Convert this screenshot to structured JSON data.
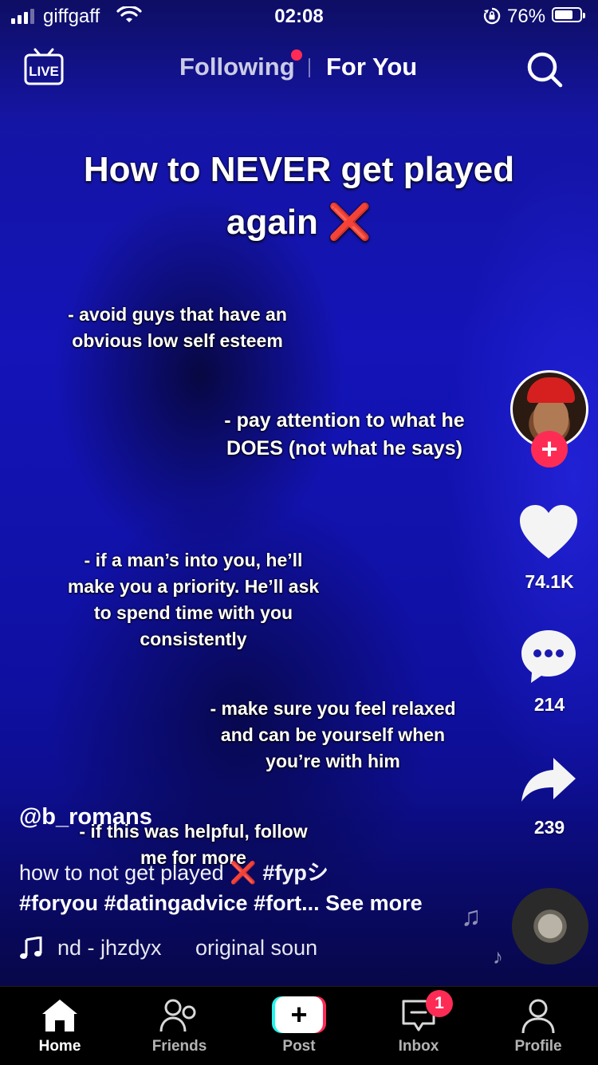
{
  "status_bar": {
    "carrier": "giffgaff",
    "time": "02:08",
    "battery_percent": "76%",
    "battery_level": 0.76
  },
  "top_nav": {
    "live_label": "LIVE",
    "following": "Following",
    "for_you": "For You"
  },
  "video": {
    "headline_line1": "How to NEVER get played",
    "headline_line2": "again",
    "headline_emoji": "❌",
    "tips": [
      [
        "- avoid guys that have an",
        "obvious low self esteem"
      ],
      [
        "- pay attention to what he",
        "DOES (not what he says)"
      ],
      [
        "- if a man’s into you, he’ll",
        "make you a priority. He’ll ask",
        "to spend time with you",
        "consistently"
      ],
      [
        "- make sure you feel relaxed",
        "and can be yourself when",
        "you’re with him"
      ],
      [
        "- if this was helpful, follow",
        "me for more"
      ]
    ]
  },
  "rail": {
    "likes": "74.1K",
    "comments": "214",
    "shares": "239"
  },
  "info": {
    "username": "@b_romans",
    "description_text": "how to not get played",
    "description_emoji": "❌",
    "description_tag": "#fypシ",
    "hashtags_line": "#foryou #datingadvice #fort...",
    "see_more": "See more",
    "music_text_1": "nd - jhzdyx",
    "music_text_2": "original soun"
  },
  "bottom_nav": {
    "home": "Home",
    "friends": "Friends",
    "post": "Post",
    "post_symbol": "+",
    "inbox": "Inbox",
    "inbox_badge": "1",
    "profile": "Profile"
  },
  "colors": {
    "accent": "#fe2c55",
    "cyan": "#25f4ee",
    "video_blue": "#1414b8"
  }
}
